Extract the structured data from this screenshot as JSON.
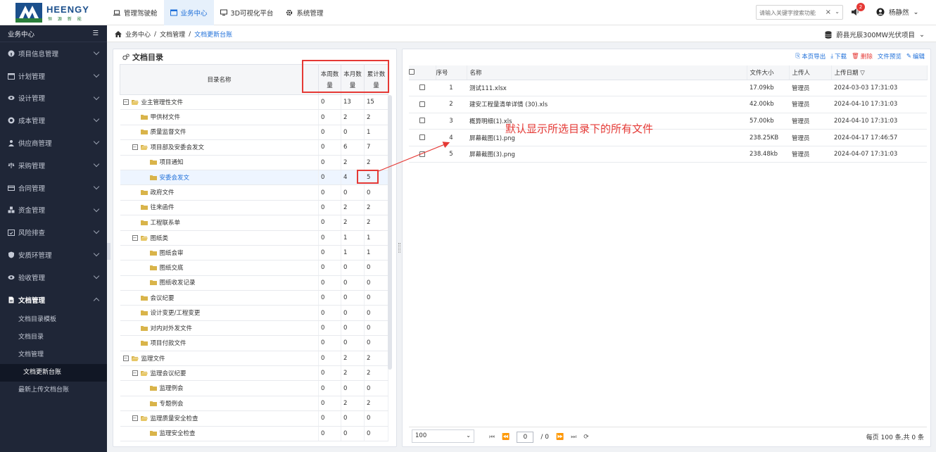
{
  "brand": {
    "name": "HEENGY",
    "sub": "恒 源 新 能"
  },
  "topnav": [
    {
      "label": "管理驾驶舱",
      "active": false
    },
    {
      "label": "业务中心",
      "active": true
    },
    {
      "label": "3D可视化平台",
      "active": false
    },
    {
      "label": "系统管理",
      "active": false
    }
  ],
  "search": {
    "placeholder": "请输入关键字搜索功能",
    "clear": "×",
    "dropdown": "⌄"
  },
  "notifications": {
    "count": "2"
  },
  "user": {
    "name": "杨静然"
  },
  "sidebar": {
    "title": "业务中心",
    "items": [
      {
        "label": "项目信息管理"
      },
      {
        "label": "计划管理"
      },
      {
        "label": "设计管理"
      },
      {
        "label": "成本管理"
      },
      {
        "label": "供应商管理"
      },
      {
        "label": "采购管理"
      },
      {
        "label": "合同管理"
      },
      {
        "label": "资金管理"
      },
      {
        "label": "风险排查"
      },
      {
        "label": "安质环管理"
      },
      {
        "label": "验收管理"
      },
      {
        "label": "文档管理"
      }
    ],
    "sub_items": [
      {
        "label": "文档目录模板"
      },
      {
        "label": "文档目录"
      },
      {
        "label": "文档管理"
      },
      {
        "label": "文档更新台账"
      },
      {
        "label": "最新上传文档台账"
      }
    ]
  },
  "breadcrumb": {
    "home": "业务中心",
    "sep": "/",
    "mid": "文档管理",
    "current": "文档更新台账"
  },
  "project": {
    "name": "蔚县光辰300MW光伏项目"
  },
  "catalog": {
    "title": "文档目录",
    "headers": {
      "name": "目录名称",
      "week_top": "本周数",
      "week_bottom": "量",
      "month_top": "本月数",
      "month_bottom": "量",
      "total_top": "累计数",
      "total_bottom": "量"
    },
    "rows": [
      {
        "name": "业主管理性文件",
        "week": "0",
        "month": "13",
        "total": "15"
      },
      {
        "name": "甲供材文件",
        "week": "0",
        "month": "2",
        "total": "2"
      },
      {
        "name": "质量监督文件",
        "week": "0",
        "month": "0",
        "total": "1"
      },
      {
        "name": "项目部及安委会发文",
        "week": "0",
        "month": "6",
        "total": "7"
      },
      {
        "name": "项目通知",
        "week": "0",
        "month": "2",
        "total": "2"
      },
      {
        "name": "安委会发文",
        "week": "0",
        "month": "4",
        "total": "5"
      },
      {
        "name": "政府文件",
        "week": "0",
        "month": "0",
        "total": "0"
      },
      {
        "name": "往来函件",
        "week": "0",
        "month": "2",
        "total": "2"
      },
      {
        "name": "工程联系单",
        "week": "0",
        "month": "2",
        "total": "2"
      },
      {
        "name": "图纸类",
        "week": "0",
        "month": "1",
        "total": "1"
      },
      {
        "name": "图纸会审",
        "week": "0",
        "month": "1",
        "total": "1"
      },
      {
        "name": "图纸交底",
        "week": "0",
        "month": "0",
        "total": "0"
      },
      {
        "name": "图纸收发记录",
        "week": "0",
        "month": "0",
        "total": "0"
      },
      {
        "name": "会议纪要",
        "week": "0",
        "month": "0",
        "total": "0"
      },
      {
        "name": "设计变更/工程变更",
        "week": "0",
        "month": "0",
        "total": "0"
      },
      {
        "name": "对内对外发文件",
        "week": "0",
        "month": "0",
        "total": "0"
      },
      {
        "name": "项目付款文件",
        "week": "0",
        "month": "0",
        "total": "0"
      },
      {
        "name": "监理文件",
        "week": "0",
        "month": "2",
        "total": "2"
      },
      {
        "name": "监理会议纪要",
        "week": "0",
        "month": "2",
        "total": "2"
      },
      {
        "name": "监理例会",
        "week": "0",
        "month": "0",
        "total": "0"
      },
      {
        "name": "专题例会",
        "week": "0",
        "month": "2",
        "total": "2"
      },
      {
        "name": "监理质量安全检查",
        "week": "0",
        "month": "0",
        "total": "0"
      },
      {
        "name": "监理安全检查",
        "week": "0",
        "month": "0",
        "total": "0"
      }
    ]
  },
  "toolbar": {
    "export": "本页导出",
    "download": "下载",
    "delete": "删除",
    "preview": "文件预览",
    "edit": "编辑"
  },
  "files": {
    "headers": {
      "seq": "序号",
      "name": "名称",
      "size": "文件大小",
      "uploader": "上传人",
      "date": "上传日期"
    },
    "rows": [
      {
        "seq": "1",
        "name": "测试111.xlsx",
        "size": "17.09kb",
        "uploader": "管理员",
        "date": "2024-03-03 17:31:03"
      },
      {
        "seq": "2",
        "name": "建安工程量清单详情 (30).xls",
        "size": "42.00kb",
        "uploader": "管理员",
        "date": "2024-04-10 17:31:03"
      },
      {
        "seq": "3",
        "name": "概算明细(1).xls",
        "size": "57.00kb",
        "uploader": "管理员",
        "date": "2024-04-10 17:31:03"
      },
      {
        "seq": "4",
        "name": "屏幕截图(1).png",
        "size": "238.25KB",
        "uploader": "管理员",
        "date": "2024-04-17 17:46:57"
      },
      {
        "seq": "5",
        "name": "屏幕截图(3).png",
        "size": "238.48kb",
        "uploader": "管理员",
        "date": "2024-04-07 17:31:03"
      }
    ]
  },
  "pager": {
    "page_size": "100",
    "page": "0",
    "total_pages": "/ 0",
    "info": "每页 100 条,共 0 条"
  },
  "annotation": {
    "text": "默认显示所选目录下的所有文件",
    "color": "#e53935"
  },
  "colors": {
    "accent": "#1e6fd9",
    "sidebar_bg": "#1f2637",
    "danger": "#e53935",
    "folder": "#d9b44a"
  }
}
